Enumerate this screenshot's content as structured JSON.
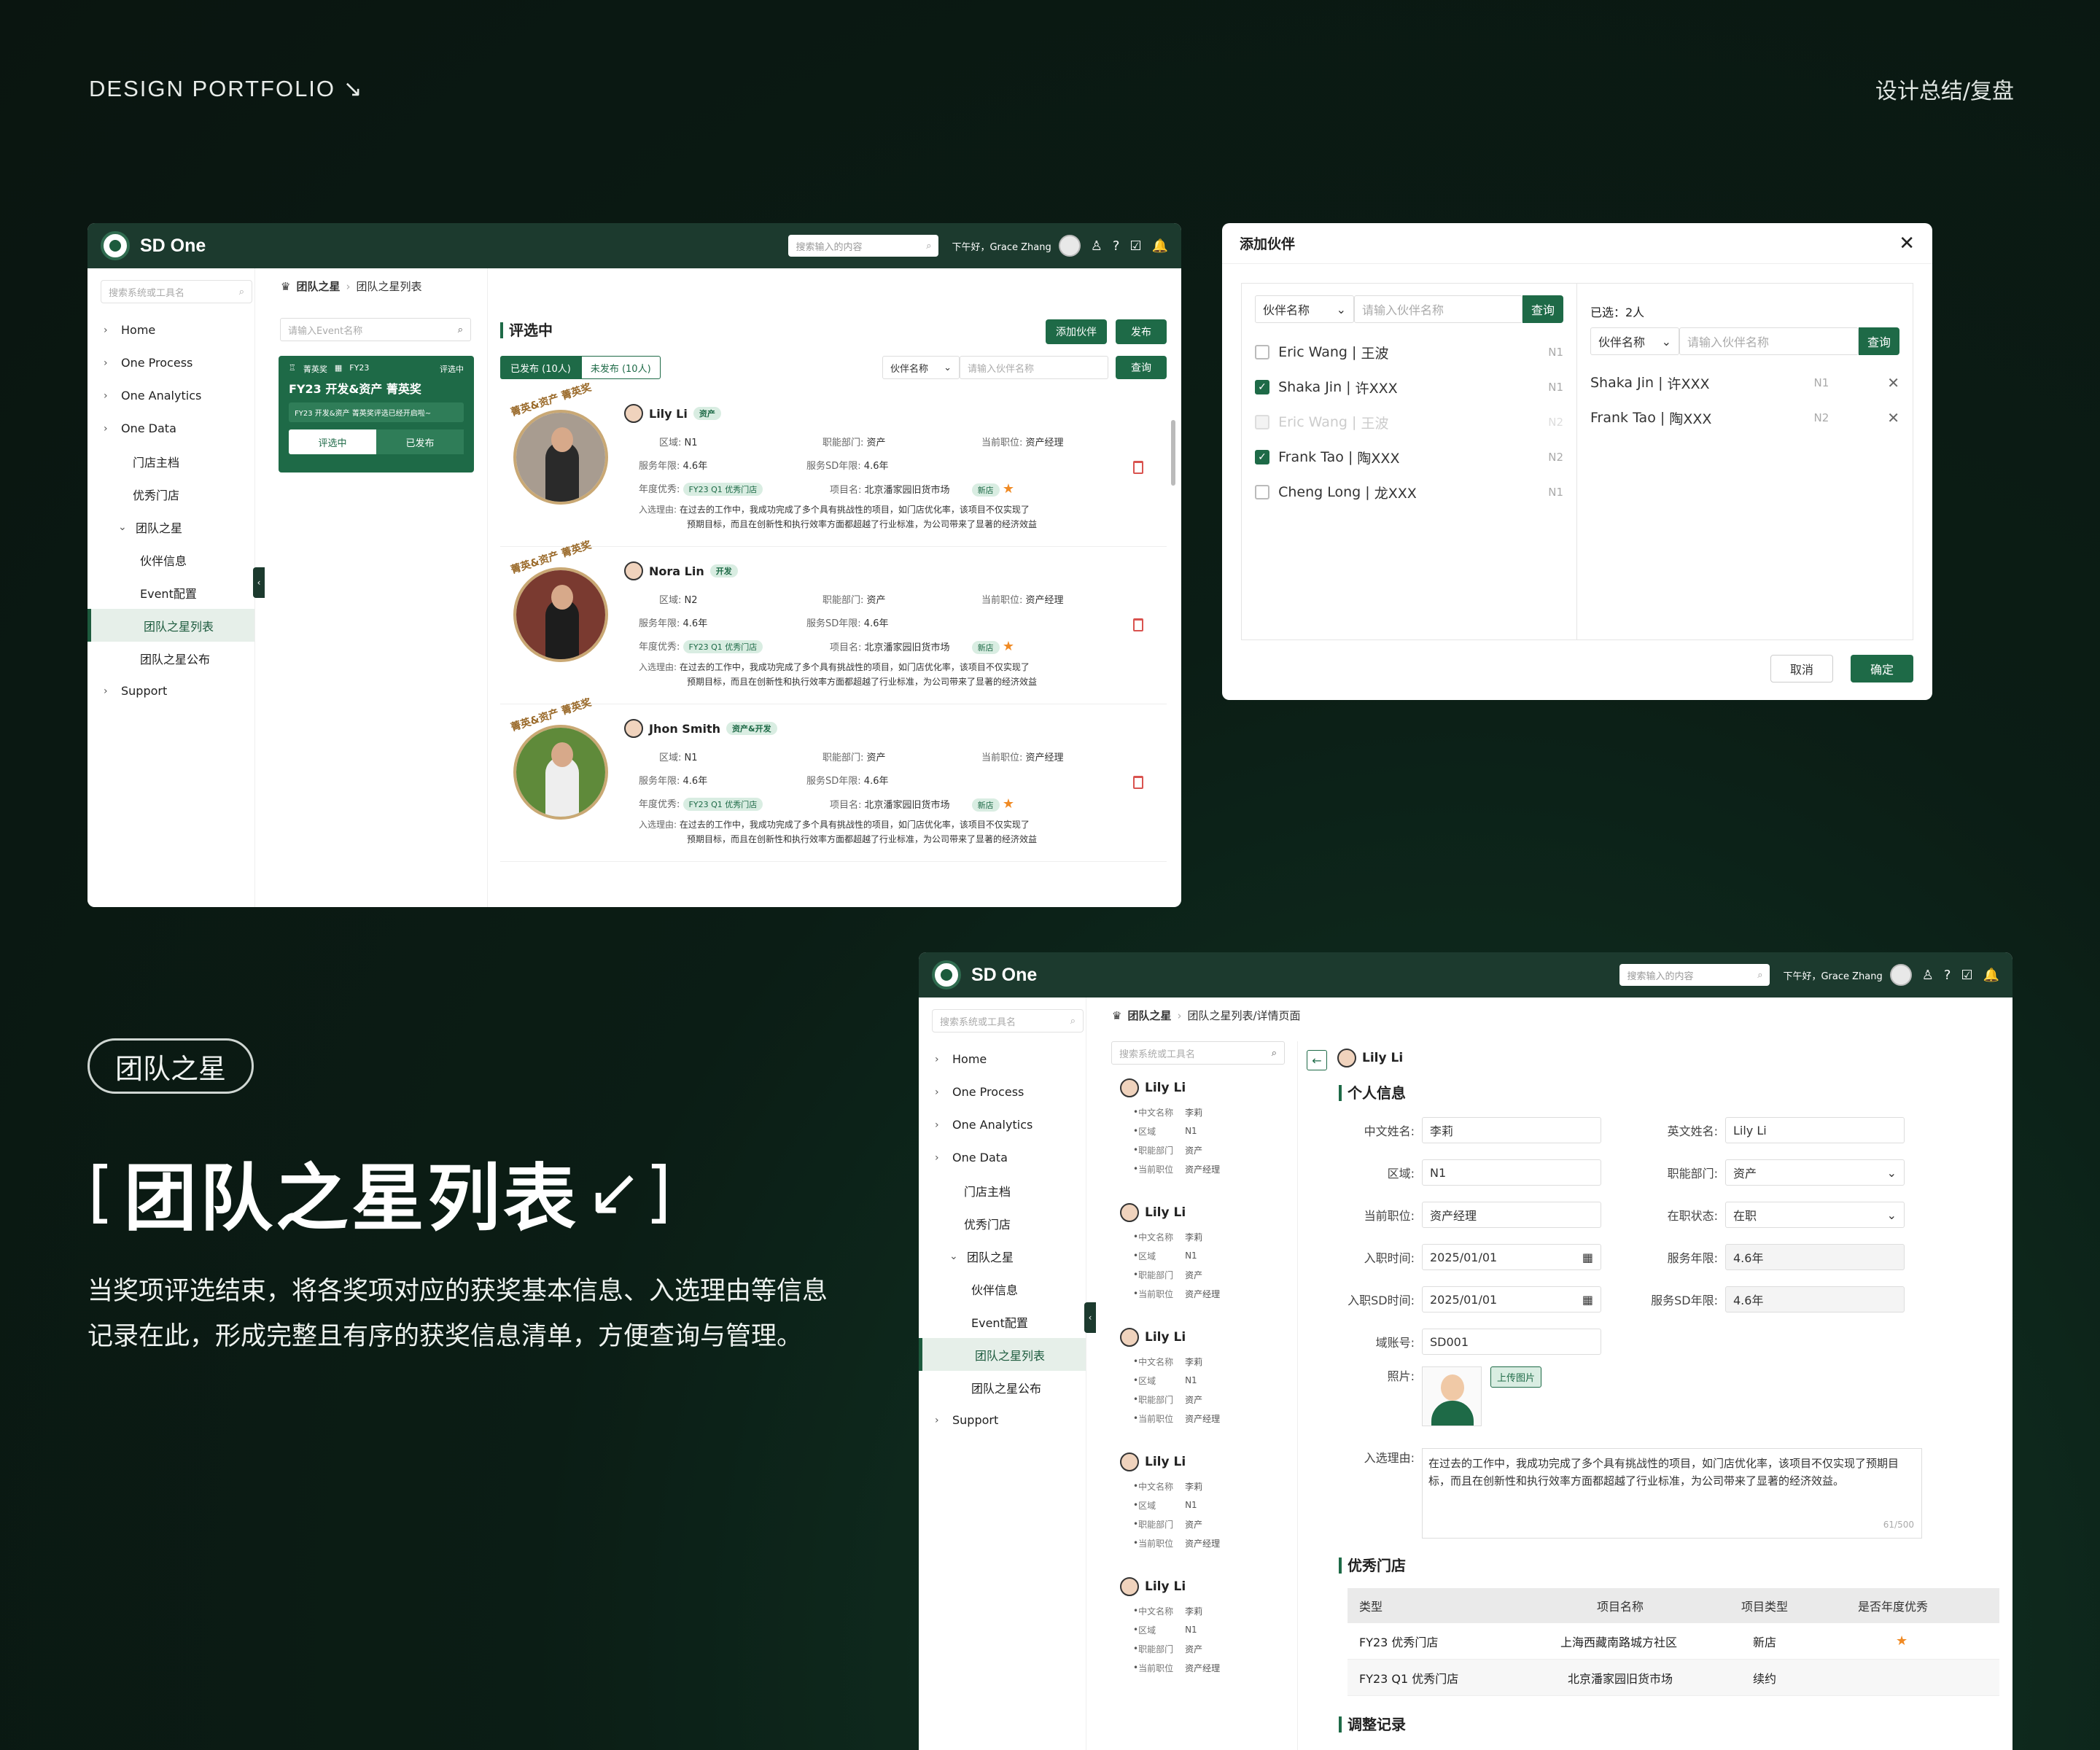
{
  "page": {
    "top_left": "DESIGN PORTFOLIO",
    "top_left_icon": "arrow-down-right-icon",
    "top_right": "设计总结/复盘",
    "pill": "团队之星",
    "big_title": "团队之星列表",
    "desc_line1": "当奖项评选结束，将各奖项对应的获奖基本信息、入选理由等信息",
    "desc_line2": "记录在此，形成完整且有序的获奖信息清单，方便查询与管理。"
  },
  "app": {
    "brand": "SD One",
    "search_placeholder": "搜索输入的内容",
    "greeting": "下午好，Grace Zhang",
    "side_search": "搜索系统或工具名",
    "nav": [
      {
        "label": "Home"
      },
      {
        "label": "One Process"
      },
      {
        "label": "One Analytics"
      },
      {
        "label": "One Data"
      },
      {
        "label": "门店主档"
      },
      {
        "label": "优秀门店"
      },
      {
        "label": "团队之星"
      },
      {
        "label": "伙伴信息"
      },
      {
        "label": "Event配置"
      },
      {
        "label": "团队之星列表"
      },
      {
        "label": "团队之星公布"
      },
      {
        "label": "Support"
      }
    ]
  },
  "list": {
    "crumb1": "团队之星",
    "crumb2": "团队之星列表",
    "event_placeholder": "请输入Event名称",
    "event": {
      "tag1": "菁英奖",
      "tag2": "FY23",
      "status": "评选中",
      "title": "FY23 开发&资产 菁英奖",
      "note": "FY23 开发&资产 菁英奖评选已经开启啦~",
      "step1": "评选中",
      "step2": "已发布"
    },
    "section": "评选中",
    "add_btn": "添加伙伴",
    "publish_btn": "发布",
    "tab_pub": "已发布 (10人)",
    "tab_unpub": "未发布 (10人)",
    "filter_select": "伙伴名称",
    "filter_placeholder": "请输入伙伴名称",
    "query_btn": "查询",
    "badge_text": "菁英&资产 菁英奖",
    "labels": {
      "area": "区域:",
      "dept": "职能部门:",
      "pos": "当前职位:",
      "years": "服务年限:",
      "sdyears": "服务SD年限:",
      "annual": "年度优秀:",
      "project": "项目名:",
      "reason": "入选理由:"
    },
    "reason_line1": "在过去的工作中，我成功完成了多个具有挑战性的项目，如门店优化率，该项目不仅实现了",
    "reason_line2": "预期目标，而且在创新性和执行效率方面都超越了行业标准，为公司带来了显著的经济效益",
    "cards": [
      {
        "name": "Lily Li",
        "tag": "资产",
        "area": "N1",
        "dept": "资产",
        "pos": "资产经理",
        "years": "4.6年",
        "sdyears": "4.6年",
        "annual": "FY23 Q1 优秀门店",
        "project": "北京潘家园旧货市场",
        "ptag": "新店"
      },
      {
        "name": "Nora Lin",
        "tag": "开发",
        "area": "N2",
        "dept": "资产",
        "pos": "资产经理",
        "years": "4.6年",
        "sdyears": "4.6年",
        "annual": "FY23 Q1 优秀门店",
        "project": "北京潘家园旧货市场",
        "ptag": "新店"
      },
      {
        "name": "Jhon Smith",
        "tag": "资产&开发",
        "area": "N1",
        "dept": "资产",
        "pos": "资产经理",
        "years": "4.6年",
        "sdyears": "4.6年",
        "annual": "FY23 Q1 优秀门店",
        "project": "北京潘家园旧货市场",
        "ptag": "新店"
      }
    ]
  },
  "modal": {
    "title": "添加伙伴",
    "select": "伙伴名称",
    "placeholder": "请输入伙伴名称",
    "query": "查询",
    "selected": "已选：2人",
    "left": [
      {
        "name": "Eric Wang",
        "cn": "王波",
        "level": "N1",
        "checked": false,
        "disabled": false
      },
      {
        "name": "Shaka Jin",
        "cn": "许XXX",
        "level": "N1",
        "checked": true,
        "disabled": false
      },
      {
        "name": "Eric Wang",
        "cn": "王波",
        "level": "N2",
        "checked": false,
        "disabled": true
      },
      {
        "name": "Frank Tao",
        "cn": "陶XXX",
        "level": "N2",
        "checked": true,
        "disabled": false
      },
      {
        "name": "Cheng Long",
        "cn": "龙XXX",
        "level": "N1",
        "checked": false,
        "disabled": false
      }
    ],
    "right": [
      {
        "name": "Shaka Jin",
        "cn": "许XXX",
        "level": "N1"
      },
      {
        "name": "Frank Tao",
        "cn": "陶XXX",
        "level": "N2"
      }
    ],
    "cancel": "取消",
    "ok": "确定"
  },
  "detail": {
    "crumb1": "团队之星",
    "crumb2": "团队之星列表/详情页面",
    "list_search": "搜索系统或工具名",
    "mini": {
      "name": "Lily Li",
      "k1": "中文名称",
      "v1": "李莉",
      "k2": "区域",
      "v2": "N1",
      "k3": "职能部门",
      "v3": "资产",
      "k4": "当前职位",
      "v4": "资产经理"
    },
    "person": "Lily Li",
    "sec1": "个人信息",
    "fields": {
      "cn_name_k": "中文姓名:",
      "cn_name_v": "李莉",
      "en_name_k": "英文姓名:",
      "en_name_v": "Lily Li",
      "area_k": "区域:",
      "area_v": "N1",
      "dept_k": "职能部门:",
      "dept_v": "资产",
      "pos_k": "当前职位:",
      "pos_v": "资产经理",
      "status_k": "在职状态:",
      "status_v": "在职",
      "join_k": "入职时间:",
      "join_v": "2025/01/01",
      "years_k": "服务年限:",
      "years_v": "4.6年",
      "sdjoin_k": "入职SD时间:",
      "sdjoin_v": "2025/01/01",
      "sdyears_k": "服务SD年限:",
      "sdyears_v": "4.6年",
      "domain_k": "域账号:",
      "domain_v": "SD001",
      "photo_k": "照片:",
      "upload": "上传图片",
      "reason_k": "入选理由:",
      "reason_v": "在过去的工作中，我成功完成了多个具有挑战性的项目，如门店优化率，该项目不仅实现了预期目标，而且在创新性和执行效率方面都超越了行业标准，为公司带来了显著的经济效益。",
      "count": "61/500"
    },
    "sec2": "优秀门店",
    "table_head": [
      "类型",
      "项目名称",
      "项目类型",
      "是否年度优秀"
    ],
    "table_rows": [
      [
        "FY23 优秀门店",
        "上海西藏南路城方社区",
        "新店",
        "★"
      ],
      [
        "FY23 Q1 优秀门店",
        "北京潘家园旧货市场",
        "续约",
        ""
      ]
    ],
    "sec3": "调整记录"
  }
}
